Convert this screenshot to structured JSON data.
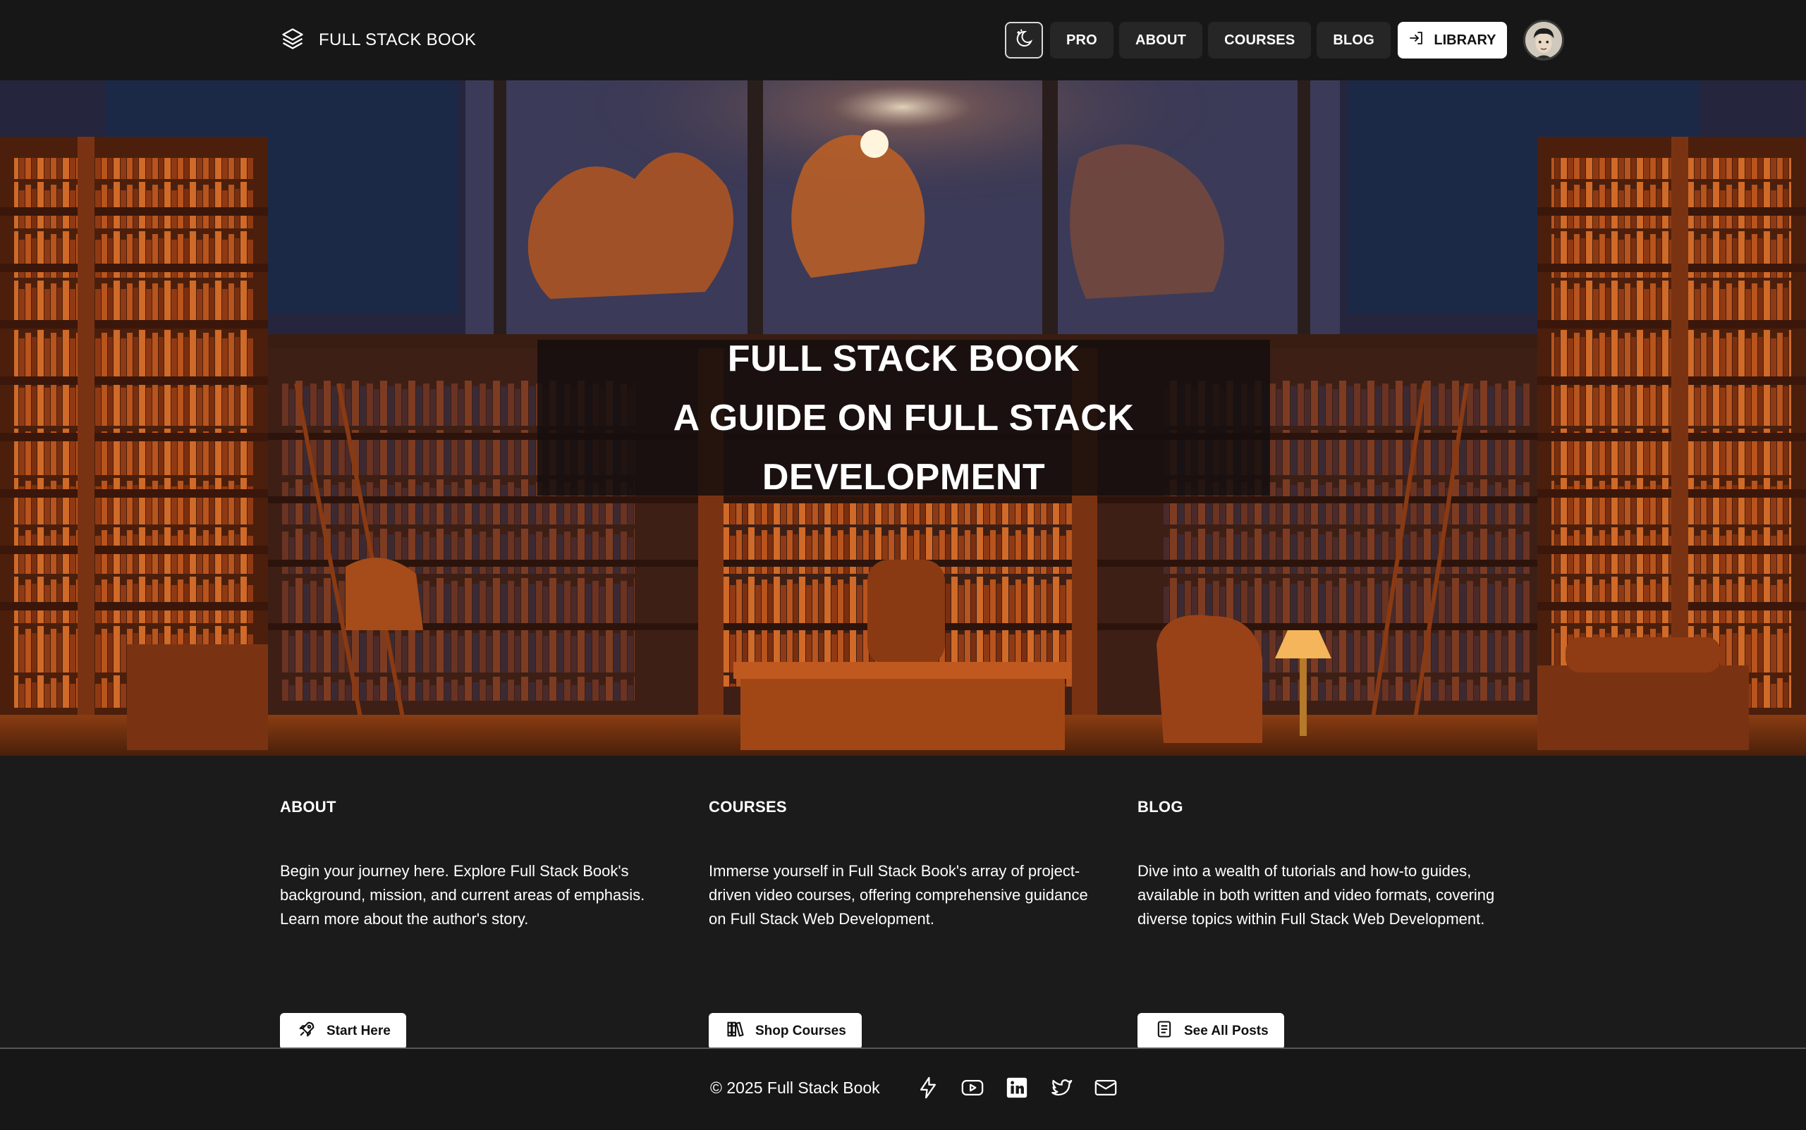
{
  "nav": {
    "brand": "FULL STACK BOOK",
    "links": [
      "PRO",
      "ABOUT",
      "COURSES",
      "BLOG"
    ],
    "library_label": "LIBRARY",
    "icons": {
      "brand": "layers-icon",
      "theme": "moon-icon",
      "library": "login-icon"
    }
  },
  "hero": {
    "title_line1": "FULL STACK BOOK",
    "title_line2": "A GUIDE ON FULL STACK DEVELOPMENT"
  },
  "sections": [
    {
      "title": "ABOUT",
      "description": "Begin your journey here. Explore Full Stack Book's background, mission, and current areas of emphasis. Learn more about the author's story.",
      "button": "Start Here",
      "icon": "rocket-icon"
    },
    {
      "title": "COURSES",
      "description": "Immerse yourself in Full Stack Book's array of project-driven video courses, offering comprehensive guidance on Full Stack Web Development.",
      "button": "Shop Courses",
      "icon": "books-icon"
    },
    {
      "title": "BLOG",
      "description": "Dive into a wealth of tutorials and how-to guides, available in both written and video formats, covering diverse topics within Full Stack Web Development.",
      "button": "See All Posts",
      "icon": "document-icon"
    }
  ],
  "footer": {
    "copyright": "© 2025 Full Stack Book",
    "icons": [
      "bolt-icon",
      "youtube-icon",
      "linkedin-icon",
      "twitter-icon",
      "mail-icon"
    ]
  },
  "colors": {
    "background": "#1b1b1b",
    "nav_background": "#171717",
    "button_background": "#ffffff",
    "hero_accent": "#c4561b"
  }
}
